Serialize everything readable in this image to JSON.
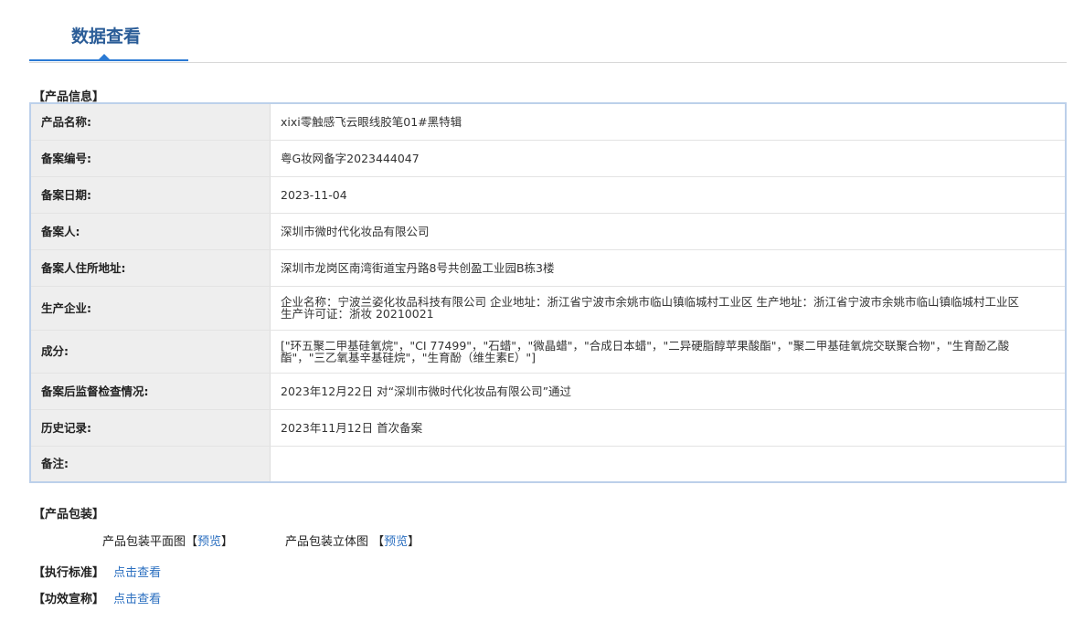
{
  "header": {
    "title": "数据查看"
  },
  "product_info": {
    "section_title": "【产品信息】",
    "rows": [
      {
        "label": "产品名称:",
        "value": "xixi零触感飞云眼线胶笔01#黑特辑"
      },
      {
        "label": "备案编号:",
        "value": "粤G妆网备字2023444047"
      },
      {
        "label": "备案日期:",
        "value": "2023-11-04"
      },
      {
        "label": "备案人:",
        "value": "深圳市微时代化妆品有限公司"
      },
      {
        "label": "备案人住所地址:",
        "value": "深圳市龙岗区南湾街道宝丹路8号共创盈工业园B栋3楼"
      },
      {
        "label": "生产企业:",
        "value": "企业名称：宁波兰姿化妆品科技有限公司 企业地址：浙江省宁波市余姚市临山镇临城村工业区 生产地址：浙江省宁波市余姚市临山镇临城村工业区 生产许可证：浙妆 20210021"
      },
      {
        "label": "成分:",
        "value": "[\"环五聚二甲基硅氧烷\"，\"CI 77499\"，\"石蜡\"，\"微晶蜡\"，\"合成日本蜡\"，\"二异硬脂醇苹果酸酯\"，\"聚二甲基硅氧烷交联聚合物\"，\"生育酚乙酸酯\"，\"三乙氧基辛基硅烷\"，\"生育酚（维生素E）\"]"
      },
      {
        "label": "备案后监督检查情况:",
        "value": "2023年12月22日 对“深圳市微时代化妆品有限公司”通过"
      },
      {
        "label": "历史记录:",
        "value": "2023年11月12日 首次备案"
      },
      {
        "label": "备注:",
        "value": ""
      }
    ]
  },
  "packaging": {
    "section_title": "【产品包装】",
    "flat_label": "产品包装平面图【",
    "flat_link": "预览",
    "flat_close": "】",
    "solid_label": "产品包装立体图 【",
    "solid_link": "预览",
    "solid_close": "】"
  },
  "standard": {
    "label": "【执行标准】",
    "link": "点击查看"
  },
  "efficacy": {
    "label": "【功效宣称】",
    "link": "点击查看"
  }
}
